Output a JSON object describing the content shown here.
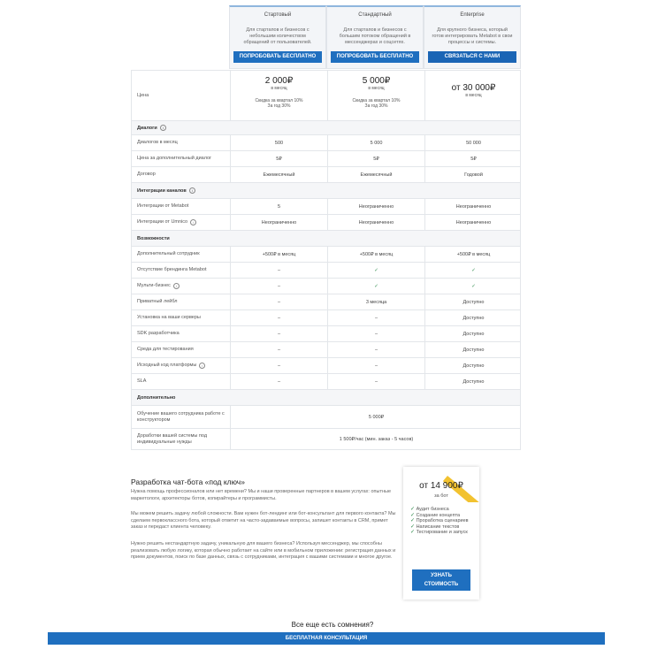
{
  "plans": [
    {
      "name": "Стартовый",
      "desc": "Для стартапов и бизнесов с небольшим количеством обращений от пользователей.",
      "cta": "ПОПРОБОВАТЬ БЕСПЛАТНО",
      "price": "2 000₽",
      "period": "в месяц",
      "discount_q": "Скидка за квартал 10%",
      "discount_y": "За год 30%"
    },
    {
      "name": "Стандартный",
      "desc": "Для стартапов и бизнесов с большим потоком обращений в мессенджерах и соцсетях.",
      "cta": "ПОПРОБОВАТЬ БЕСПЛАТНО",
      "price": "5 000₽",
      "period": "в месяц",
      "discount_q": "Скидка за квартал 10%",
      "discount_y": "За год 30%"
    },
    {
      "name": "Enterprise",
      "desc": "Для крупного бизнеса, который готов интегрировать Metabot в свои процессы и системы.",
      "cta": "СВЯЗАТЬСЯ С НАМИ",
      "price": "от 30 000₽",
      "period": "в месяц",
      "discount_q": "",
      "discount_y": ""
    }
  ],
  "price_label": "Цена",
  "sections": {
    "dialogs": "Диалоги",
    "integrations": "Интеграции каналов",
    "features": "Возможности",
    "extra": "Дополнительно"
  },
  "rows": {
    "dialogs_month": {
      "label": "Диалогов в месяц",
      "v": [
        "500",
        "5 000",
        "50 000"
      ]
    },
    "extra_dialog": {
      "label": "Цена за дополнительный диалог",
      "v": [
        "5₽",
        "5₽",
        "5₽"
      ]
    },
    "contract": {
      "label": "Договор",
      "v": [
        "Ежемесячный",
        "Ежемесячный",
        "Годовой"
      ]
    },
    "int_metabot": {
      "label": "Интеграции от Metabot",
      "v": [
        "5",
        "Неограниченно",
        "Неограниченно"
      ]
    },
    "int_umnico": {
      "label": "Интеграции от Umnico",
      "v": [
        "Неограниченно",
        "Неограниченно",
        "Неограниченно"
      ]
    },
    "extra_staff": {
      "label": "Дополнительный сотрудник",
      "v": [
        "+500₽ в месяц",
        "+500₽ в месяц",
        "+500₽ в месяц"
      ]
    },
    "no_branding": {
      "label": "Отсутствие брендинга Metabot",
      "v": [
        "–",
        "✓",
        "✓"
      ]
    },
    "multi_biz": {
      "label": "Мульти-бизнес",
      "v": [
        "–",
        "✓",
        "✓"
      ]
    },
    "private_lab": {
      "label": "Приватный лейбл",
      "v": [
        "–",
        "3 месяца",
        "Доступно"
      ]
    },
    "own_servers": {
      "label": "Установка на ваши серверы",
      "v": [
        "–",
        "–",
        "Доступно"
      ]
    },
    "sdk": {
      "label": "SDK разработчика",
      "v": [
        "–",
        "–",
        "Доступно"
      ]
    },
    "test_env": {
      "label": "Среда для тестирования",
      "v": [
        "–",
        "–",
        "Доступно"
      ]
    },
    "source": {
      "label": "Исходный код платформы",
      "v": [
        "–",
        "–",
        "Доступно"
      ]
    },
    "sla": {
      "label": "SLA",
      "v": [
        "–",
        "–",
        "Доступно"
      ]
    },
    "training": {
      "label": "Обучение вашего сотрудника работе с конструктором",
      "v": "5 000₽"
    },
    "custom_dev": {
      "label": "Доработки вашей системы под индивидуальные нужды",
      "v": "1 500₽/час (мин. заказ - 5 часов)"
    }
  },
  "turnkey": {
    "title": "Разработка чат-бота «под ключ»",
    "p1": "Нужна помощь профессионалов или нет времени? Мы и наши проверенные партнеров в вашем услугах: опытные маркетологи, архитекторы ботов, копирайтеры и программисты.",
    "p2": "Мы можем решить задачу любой сложности. Вам нужен бот-лендинг или бот-консультант для первого контакта? Мы сделаем первоклассного бота, который ответит на часто-задаваемые вопросы, запишет контакты в CRM, примет заказ и передаст клиента человеку.",
    "p3": "Нужно решить нестандартную задачу, уникальную для вашего бизнеса? Используя мессенджер, мы способны реализовать любую логику, которая обычно работает на сайте или в мобильном приложении: регистрация данных и прием документов, поиск по базе данных, связь с сотрудниками, интеграция с вашими системами и многое другое."
  },
  "card": {
    "price": "от 14 900₽",
    "unit": "за бот",
    "features": [
      "Аудит бизнеса",
      "Создание концепта",
      "Прорaботка сценариев",
      "Написание текстов",
      "Тестирование и запуск"
    ],
    "cta_line1": "УЗНАТЬ",
    "cta_line2": "СТОИМОСТЬ"
  },
  "doubts": "Все еще есть сомнения?",
  "consult": "БЕСПЛАТНАЯ КОНСУЛЬТАЦИЯ",
  "colors": {
    "accent": "#1f6fbf",
    "check": "#2d8a4a",
    "ribbon": "#f2c230"
  }
}
